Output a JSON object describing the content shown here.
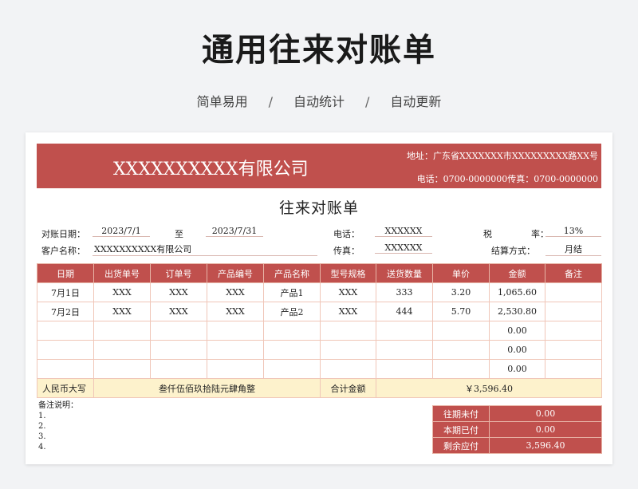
{
  "header": {
    "title": "通用往来对账单",
    "features": [
      "简单易用",
      "自动统计",
      "自动更新"
    ],
    "separator": "/"
  },
  "banner": {
    "company": "XXXXXXXXXX有限公司",
    "address": "地址：广东省XXXXXXX市XXXXXXXXX路XX号",
    "phones": "电话：0700-0000000传真：0700-0000000"
  },
  "doc": {
    "title": "往来对账单",
    "date_label": "对账日期：",
    "date_from": "2023/7/1",
    "to_label": "至",
    "date_to": "2023/7/31",
    "phone_label": "电话：",
    "phone_value": "XXXXXX",
    "tax_label_1": "税",
    "tax_label_2": "率：",
    "tax_value": "13%",
    "customer_label": "客户名称：",
    "customer_value": "XXXXXXXXXX有限公司",
    "fax_label": "传真：",
    "fax_value": "XXXXXX",
    "settle_label": "结算方式：",
    "settle_value": "月结"
  },
  "table": {
    "columns": [
      "日期",
      "出货单号",
      "订单号",
      "产品编号",
      "产品名称",
      "型号规格",
      "送货数量",
      "单价",
      "金额",
      "备注"
    ],
    "rows": [
      [
        "7月1日",
        "XXX",
        "XXX",
        "XXX",
        "产品1",
        "XXX",
        "333",
        "3.20",
        "1,065.60",
        ""
      ],
      [
        "7月2日",
        "XXX",
        "XXX",
        "XXX",
        "产品2",
        "XXX",
        "444",
        "5.70",
        "2,530.80",
        ""
      ],
      [
        "",
        "",
        "",
        "",
        "",
        "",
        "",
        "",
        "0.00",
        ""
      ],
      [
        "",
        "",
        "",
        "",
        "",
        "",
        "",
        "",
        "0.00",
        ""
      ],
      [
        "",
        "",
        "",
        "",
        "",
        "",
        "",
        "",
        "0.00",
        ""
      ]
    ],
    "rmb_label": "人民币大写",
    "rmb_value": "叁仟伍佰玖拾陆元肆角整",
    "total_label": "合计金额",
    "total_value": "￥3,596.40"
  },
  "notes": {
    "title": "备注说明：",
    "items": [
      "1.",
      "2.",
      "3.",
      "4."
    ]
  },
  "summary": [
    {
      "label": "往期未付",
      "value": "0.00"
    },
    {
      "label": "本期已付",
      "value": "0.00"
    },
    {
      "label": "剩余应付",
      "value": "3,596.40"
    }
  ],
  "colors": {
    "accent": "#c0504d",
    "highlight": "#fdf2cc"
  }
}
